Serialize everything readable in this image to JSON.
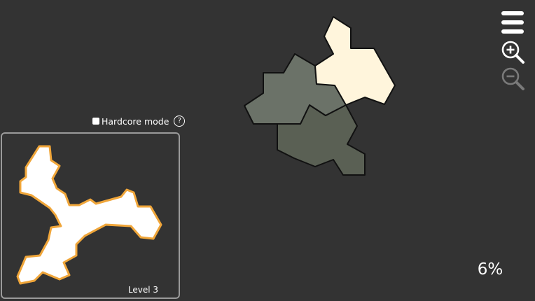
{
  "controls": {
    "menu_icon": "hamburger-menu-icon",
    "zoom_in_icon": "zoom-in-icon",
    "zoom_out_icon": "zoom-out-icon"
  },
  "hardcore": {
    "label": "Hardcore mode",
    "help": "?",
    "checked": false
  },
  "preview": {
    "level_label": "Level 3"
  },
  "progress": "6%",
  "colors": {
    "background": "#333333",
    "piece_cream": "#fff5dc",
    "piece_gray": "#6b7268",
    "piece_dark": "#5a6054",
    "target_outline": "#f0a63a",
    "target_fill": "#ffffff"
  }
}
